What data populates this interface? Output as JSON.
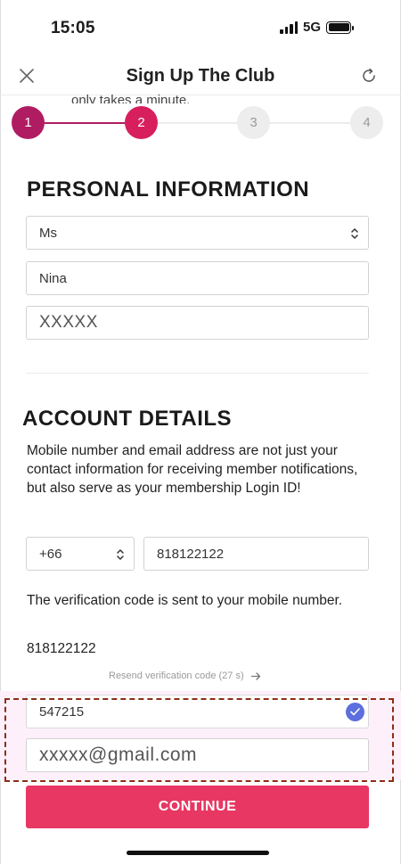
{
  "status_bar": {
    "time": "15:05",
    "network": "5G"
  },
  "header": {
    "title": "Sign Up The Club",
    "subtitle_partial": "only takes a minute."
  },
  "stepper": {
    "steps": [
      {
        "label": "1",
        "state": "done"
      },
      {
        "label": "2",
        "state": "active"
      },
      {
        "label": "3",
        "state": "todo"
      },
      {
        "label": "4",
        "state": "todo"
      }
    ]
  },
  "personal": {
    "heading": "PERSONAL INFORMATION",
    "title_select": "Ms",
    "first_name": "Nina",
    "last_name": "XXXXX"
  },
  "account": {
    "heading": "ACCOUNT DETAILS",
    "description": "Mobile number and email address are not just your contact information for receiving member notifications, but also serve as your membership Login ID!",
    "country_code": "+66",
    "phone": "818122122",
    "verification_note": "The verification code is sent to your mobile number.",
    "sent_to_number": "818122122",
    "resend_label": "Resend verification code (27 s)",
    "verification_code": "547215",
    "email": "xxxxx@gmail.com"
  },
  "cta": {
    "label": "CONTINUE"
  },
  "colors": {
    "accent": "#d81f5d",
    "step_done": "#b01c62",
    "cta": "#e83763",
    "verified_badge": "#5d6ede",
    "highlight_border": "#8b2e15"
  }
}
